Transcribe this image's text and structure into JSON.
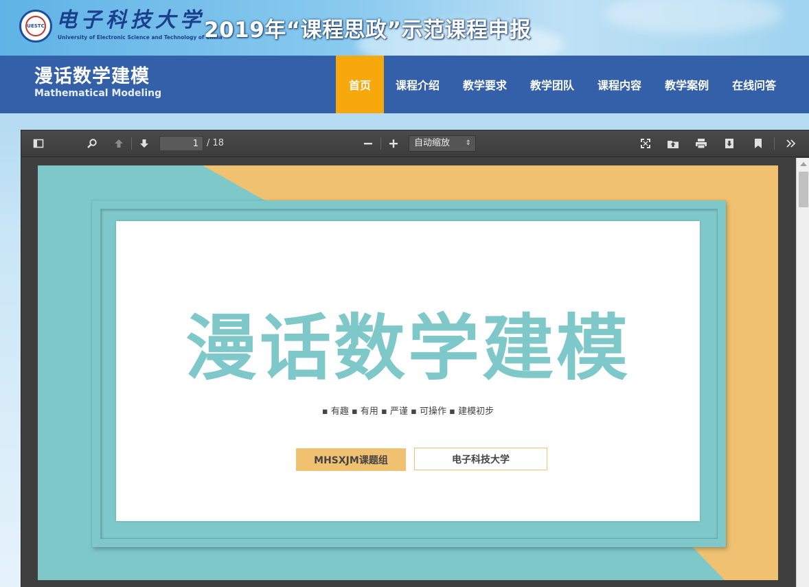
{
  "banner": {
    "university_cn": "电子科技大学",
    "university_en": "University of Electronic Science and Technology of China",
    "seal_text": "UESTC",
    "page_heading": "2019年“课程思政”示范课程申报"
  },
  "site": {
    "title_cn": "漫话数学建模",
    "title_en": "Mathematical Modeling"
  },
  "nav": {
    "items": [
      {
        "label": "首页",
        "active": true
      },
      {
        "label": "课程介绍",
        "active": false
      },
      {
        "label": "教学要求",
        "active": false
      },
      {
        "label": "教学团队",
        "active": false
      },
      {
        "label": "课程内容",
        "active": false
      },
      {
        "label": "教学案例",
        "active": false
      },
      {
        "label": "在线问答",
        "active": false
      }
    ],
    "active_color": "#f6a80d",
    "bar_color": "#3460a9"
  },
  "pdf_viewer": {
    "current_page": "1",
    "page_count": "/ 18",
    "zoom": "自动缩放",
    "toolbar_icons": [
      "sidebar-toggle-icon",
      "search-icon",
      "previous-page-icon",
      "next-page-icon",
      "zoom-out-icon",
      "zoom-in-icon",
      "presentation-mode-icon",
      "open-file-icon",
      "print-icon",
      "download-icon",
      "bookmark-icon",
      "tools-icon"
    ]
  },
  "slide": {
    "title": "漫话数学建模",
    "tagline": "▪ 有趣 ▪ 有用 ▪ 严谨 ▪ 可操作 ▪ 建模初步",
    "group_label": "MHSXJM课题组",
    "university_label": "电子科技大学",
    "teal_color": "#7ec8c9",
    "gold_color": "#efc170"
  }
}
